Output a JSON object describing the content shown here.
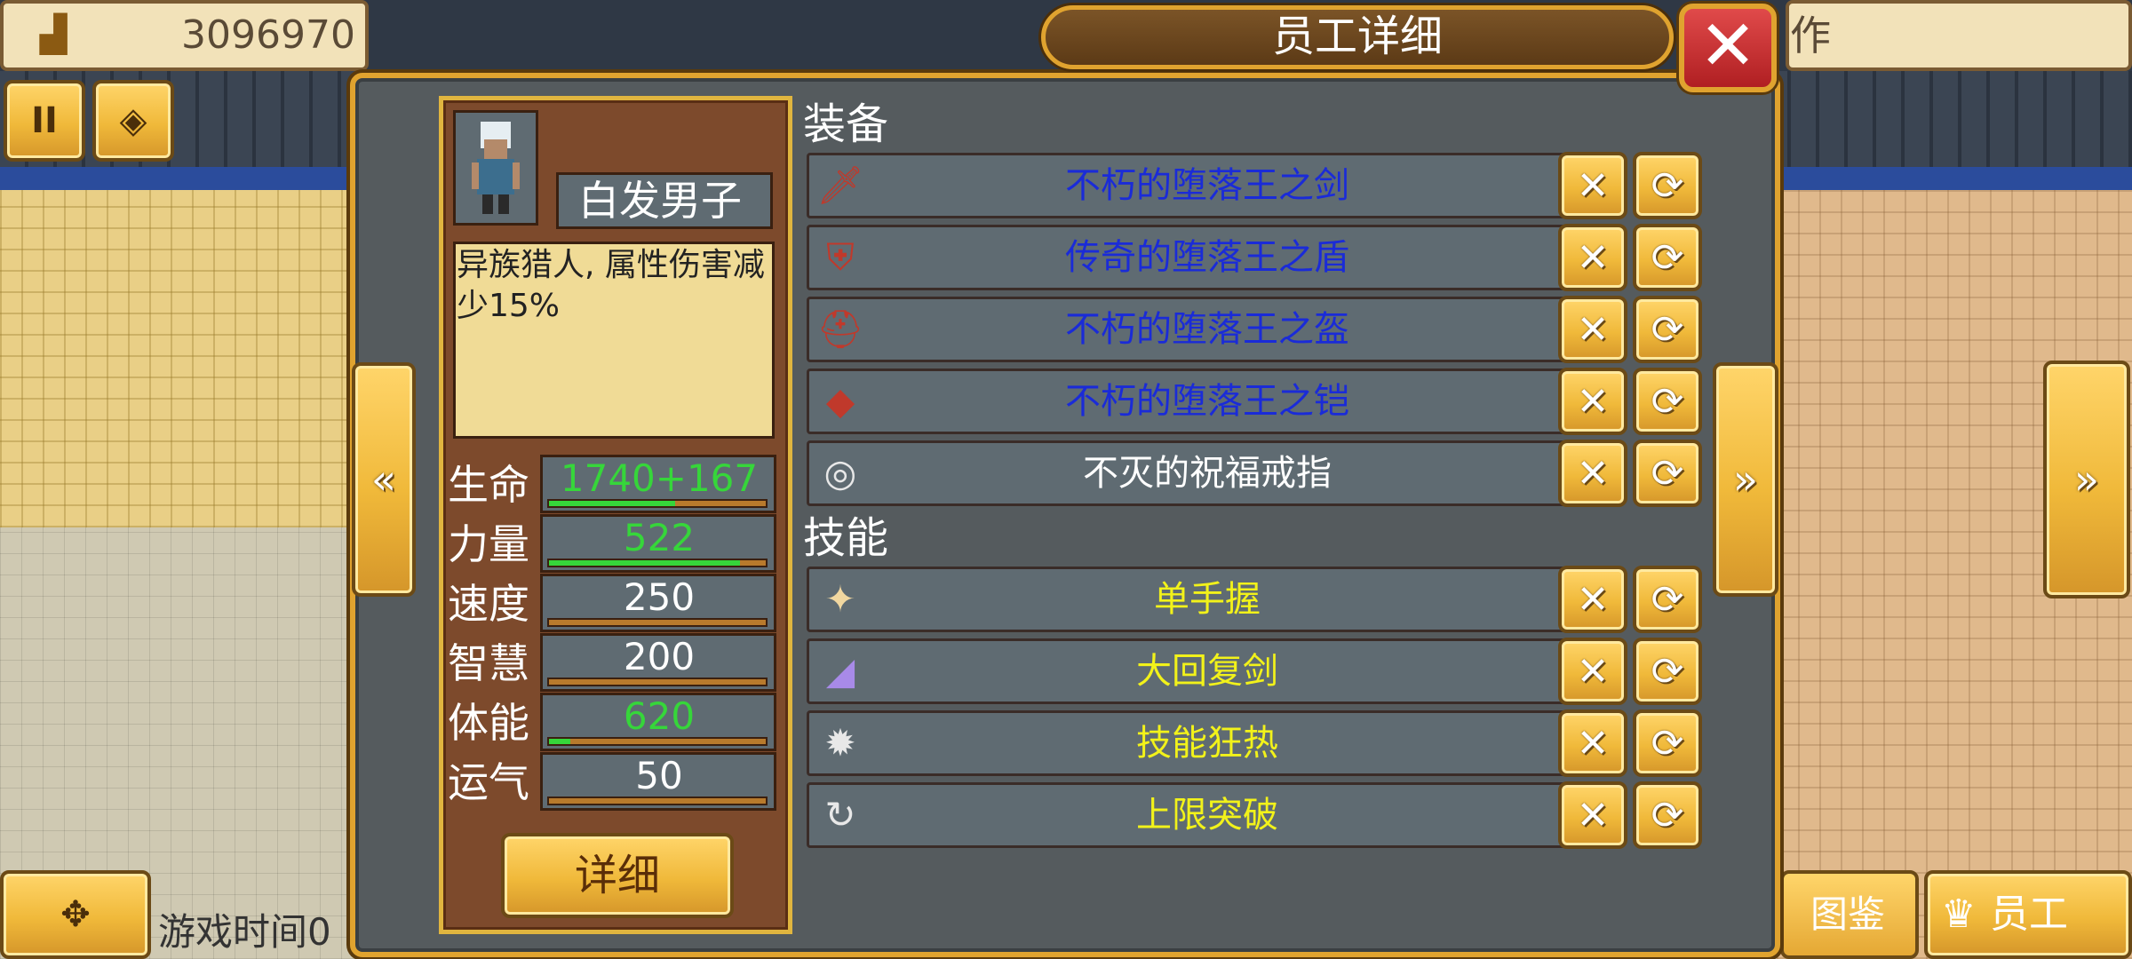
{
  "hud": {
    "money": "3096970",
    "money_icon": "gold-stack-icon",
    "right_top_partial": "作",
    "game_time": "游戏时间0",
    "tujian_label": "图鉴",
    "staff_label": "员工"
  },
  "dialog": {
    "title": "员工详细",
    "close_glyph": "✕"
  },
  "character": {
    "name": "白发男子",
    "description": "异族猎人, 属性伤害减少15%",
    "stats": [
      {
        "label": "生命",
        "value": "1740+167",
        "fill": 0.58,
        "color": "#36d63a"
      },
      {
        "label": "力量",
        "value": "522",
        "fill": 0.88,
        "color": "#36d63a"
      },
      {
        "label": "速度",
        "value": "250",
        "fill": 0.0,
        "color": "#ffffff"
      },
      {
        "label": "智慧",
        "value": "200",
        "fill": 0.0,
        "color": "#ffffff"
      },
      {
        "label": "体能",
        "value": "620",
        "fill": 0.1,
        "color": "#36d63a"
      },
      {
        "label": "运气",
        "value": "50",
        "fill": 0.0,
        "color": "#ffffff"
      }
    ],
    "detail_button": "详细"
  },
  "equipment": {
    "title": "装备",
    "items": [
      {
        "name": "不朽的堕落王之剑",
        "color": "#1a2bd8",
        "icon": "sword-icon"
      },
      {
        "name": "传奇的堕落王之盾",
        "color": "#1a2bd8",
        "icon": "shield-icon"
      },
      {
        "name": "不朽的堕落王之盔",
        "color": "#1a2bd8",
        "icon": "helmet-icon"
      },
      {
        "name": "不朽的堕落王之铠",
        "color": "#1a2bd8",
        "icon": "armor-icon"
      },
      {
        "name": "不灭的祝福戒指",
        "color": "#ffffff",
        "icon": "ring-icon"
      }
    ]
  },
  "skills": {
    "title": "技能",
    "items": [
      {
        "name": "单手握",
        "color": "#f2f21a",
        "icon": "blade-icon"
      },
      {
        "name": "大回复剑",
        "color": "#f2f21a",
        "icon": "crystal-sword-icon"
      },
      {
        "name": "技能狂热",
        "color": "#f2f21a",
        "icon": "skill-fever-icon"
      },
      {
        "name": "上限突破",
        "color": "#f2f21a",
        "icon": "limit-break-icon"
      }
    ]
  },
  "glyphs": {
    "remove": "✕",
    "swap": "⟳",
    "prev": "«",
    "next": "»",
    "pause": "II",
    "move": "✥"
  }
}
